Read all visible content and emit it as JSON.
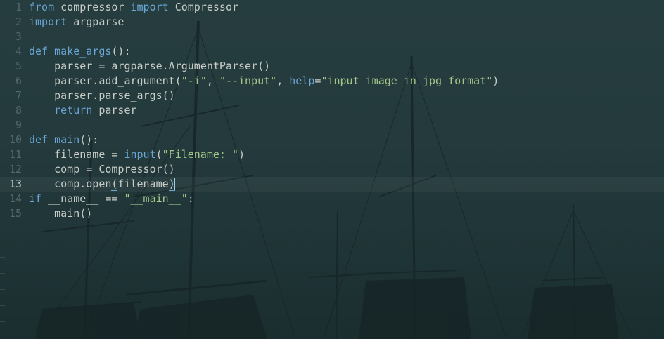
{
  "editor": {
    "current_line": 13,
    "lines": [
      {
        "number": "1",
        "tokens": [
          {
            "t": "from",
            "k": "keyword"
          },
          {
            "t": " compressor ",
            "k": "plain"
          },
          {
            "t": "import",
            "k": "keyword"
          },
          {
            "t": " Compressor",
            "k": "plain"
          }
        ]
      },
      {
        "number": "2",
        "tokens": [
          {
            "t": "import",
            "k": "keyword"
          },
          {
            "t": " argparse",
            "k": "plain"
          }
        ]
      },
      {
        "number": "3",
        "tokens": []
      },
      {
        "number": "4",
        "tokens": [
          {
            "t": "def",
            "k": "keyword"
          },
          {
            "t": " ",
            "k": "plain"
          },
          {
            "t": "make_args",
            "k": "func"
          },
          {
            "t": "():",
            "k": "plain"
          }
        ]
      },
      {
        "number": "5",
        "tokens": [
          {
            "t": "    parser = argparse.ArgumentParser()",
            "k": "plain"
          }
        ]
      },
      {
        "number": "6",
        "tokens": [
          {
            "t": "    parser.add_argument(",
            "k": "plain"
          },
          {
            "t": "\"-i\"",
            "k": "string"
          },
          {
            "t": ", ",
            "k": "plain"
          },
          {
            "t": "\"--input\"",
            "k": "string"
          },
          {
            "t": ", ",
            "k": "plain"
          },
          {
            "t": "help",
            "k": "builtin"
          },
          {
            "t": "=",
            "k": "plain"
          },
          {
            "t": "\"input image in jpg format\"",
            "k": "string"
          },
          {
            "t": ")",
            "k": "plain"
          }
        ]
      },
      {
        "number": "7",
        "tokens": [
          {
            "t": "    parser.parse_args()",
            "k": "plain"
          }
        ]
      },
      {
        "number": "8",
        "tokens": [
          {
            "t": "    ",
            "k": "plain"
          },
          {
            "t": "return",
            "k": "keyword"
          },
          {
            "t": " parser",
            "k": "plain"
          }
        ]
      },
      {
        "number": "9",
        "tokens": []
      },
      {
        "number": "10",
        "tokens": [
          {
            "t": "def",
            "k": "keyword"
          },
          {
            "t": " ",
            "k": "plain"
          },
          {
            "t": "main",
            "k": "func"
          },
          {
            "t": "():",
            "k": "plain"
          }
        ]
      },
      {
        "number": "11",
        "tokens": [
          {
            "t": "    filename = ",
            "k": "plain"
          },
          {
            "t": "input",
            "k": "builtin"
          },
          {
            "t": "(",
            "k": "plain"
          },
          {
            "t": "\"Filename: \"",
            "k": "string"
          },
          {
            "t": ")",
            "k": "plain"
          }
        ]
      },
      {
        "number": "12",
        "tokens": [
          {
            "t": "    comp = Compressor()",
            "k": "plain"
          }
        ]
      },
      {
        "number": "13",
        "tokens": [
          {
            "t": "    comp.open",
            "k": "plain"
          },
          {
            "t": "(",
            "k": "bracket-match"
          },
          {
            "t": "filename",
            "k": "plain"
          },
          {
            "t": ")",
            "k": "bracket-match"
          }
        ],
        "cursor": true
      },
      {
        "number": "14",
        "tokens": [
          {
            "t": "if",
            "k": "keyword"
          },
          {
            "t": " __name__ == ",
            "k": "plain"
          },
          {
            "t": "\"__main__\"",
            "k": "string"
          },
          {
            "t": ":",
            "k": "plain"
          }
        ]
      },
      {
        "number": "15",
        "tokens": [
          {
            "t": "    main()",
            "k": "plain"
          }
        ]
      }
    ]
  },
  "colors": {
    "background": "#243a3c",
    "keyword": "#6aa6d6",
    "plain": "#c9cdc8",
    "string": "#a4c98a",
    "gutter": "#52686a",
    "cursor": "#9ad0e8"
  },
  "background_image": "sailing-ship-masts-wallpaper"
}
